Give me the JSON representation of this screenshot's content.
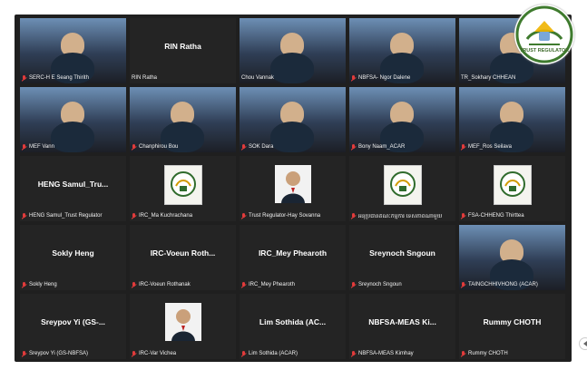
{
  "badge": {
    "text": "TRUST REGULATOR"
  },
  "tiles": [
    {
      "name": "SERC-H E Seang Thirith",
      "label": "SERC-H E Seang Thirith",
      "center": "",
      "kind": "video",
      "muted": true
    },
    {
      "name": "RIN Ratha",
      "label": "RIN Ratha",
      "center": "RIN Ratha",
      "kind": "name",
      "muted": false
    },
    {
      "name": "Chou Vannak",
      "label": "Chou Vannak",
      "center": "",
      "kind": "video",
      "muted": false,
      "speaker": true
    },
    {
      "name": "NBFSA- Ngor Dalene",
      "label": "NBFSA- Ngor Dalene",
      "center": "",
      "kind": "video",
      "muted": true
    },
    {
      "name": "TR_Sokhary CHHEAN",
      "label": "TR_Sokhary CHHEAN",
      "center": "",
      "kind": "video",
      "muted": false
    },
    {
      "name": "MEF Vann",
      "label": "MEF Vann",
      "center": "",
      "kind": "video",
      "muted": true
    },
    {
      "name": "Chanphirou Bou",
      "label": "Chanphirou Bou",
      "center": "",
      "kind": "video",
      "muted": true
    },
    {
      "name": "SOK Dara",
      "label": "SOK Dara",
      "center": "",
      "kind": "video",
      "muted": true
    },
    {
      "name": "Bony Naam_ACAR",
      "label": "Bony Naam_ACAR",
      "center": "",
      "kind": "video",
      "muted": true
    },
    {
      "name": "MEF_Ros Seilava",
      "label": "MEF_Ros Seilava",
      "center": "",
      "kind": "video",
      "muted": true
    },
    {
      "name": "HENG Samul_Trust Regulator",
      "label": "HENG Samul_Trust Regulator",
      "center": "HENG Samul_Tru...",
      "kind": "name",
      "muted": true
    },
    {
      "name": "IRC_Ma Kuchrachana",
      "label": "IRC_Ma Kuchrachana",
      "center": "",
      "kind": "logo",
      "muted": true
    },
    {
      "name": "Trust Regulator-Hay Sovanna",
      "label": "Trust Regulator-Hay Sovanna",
      "center": "",
      "kind": "avatar",
      "muted": true
    },
    {
      "name": "អនុប្រធាន",
      "label": "អនុប្រធានគណៈកម្មការ ទេសភាពណាមួយ",
      "center": "",
      "kind": "logo",
      "muted": true
    },
    {
      "name": "FSA-CHHENG Thirttea",
      "label": "FSA-CHHENG Thirttea",
      "center": "",
      "kind": "logo",
      "muted": true
    },
    {
      "name": "Sokly Heng",
      "label": "Sokly Heng",
      "center": "Sokly Heng",
      "kind": "name",
      "muted": true
    },
    {
      "name": "IRC-Voeun Rothanak",
      "label": "IRC-Voeun Rothanak",
      "center": "IRC-Voeun Roth...",
      "kind": "name",
      "muted": true
    },
    {
      "name": "IRC_Mey Phearoth",
      "label": "IRC_Mey Phearoth",
      "center": "IRC_Mey Phearoth",
      "kind": "name",
      "muted": true
    },
    {
      "name": "Sreynoch Sngoun",
      "label": "Sreynoch Sngoun",
      "center": "Sreynoch Sngoun",
      "kind": "name",
      "muted": true
    },
    {
      "name": "TAINGCHHIVHONG (ACAR)",
      "label": "TAINGCHHIVHONG (ACAR)",
      "center": "",
      "kind": "video",
      "muted": true
    },
    {
      "name": "Sreypov Yi (GS-NBFSA)",
      "label": "Sreypov Yi (GS-NBFSA)",
      "center": "Sreypov Yi (GS-...",
      "kind": "name",
      "muted": true
    },
    {
      "name": "IRC-Var Vichea",
      "label": "IRC-Var Vichea",
      "center": "",
      "kind": "avatar",
      "muted": true
    },
    {
      "name": "Lim Sothida (ACAR)",
      "label": "Lim Sothida (ACAR)",
      "center": "Lim Sothida (AC...",
      "kind": "name",
      "muted": true
    },
    {
      "name": "NBFSA-MEAS Kimhay",
      "label": "NBFSA-MEAS Kimhay",
      "center": "NBFSA-MEAS Ki...",
      "kind": "name",
      "muted": true
    },
    {
      "name": "Rummy CHOTH",
      "label": "Rummy CHOTH",
      "center": "Rummy CHOTH",
      "kind": "name",
      "muted": true
    }
  ]
}
